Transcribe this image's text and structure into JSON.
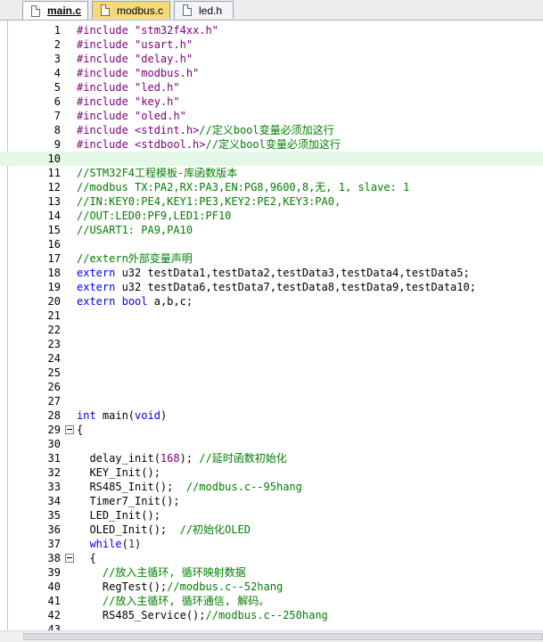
{
  "tabs": [
    {
      "label": "main.c"
    },
    {
      "label": "modbus.c"
    },
    {
      "label": "led.h"
    }
  ],
  "lines": [
    {
      "n": "1",
      "t": [
        [
          "pp",
          "#include "
        ],
        [
          "str",
          "\"stm32f4xx.h\""
        ]
      ]
    },
    {
      "n": "2",
      "t": [
        [
          "pp",
          "#include "
        ],
        [
          "str",
          "\"usart.h\""
        ]
      ]
    },
    {
      "n": "3",
      "t": [
        [
          "pp",
          "#include "
        ],
        [
          "str",
          "\"delay.h\""
        ]
      ]
    },
    {
      "n": "4",
      "t": [
        [
          "pp",
          "#include "
        ],
        [
          "str",
          "\"modbus.h\""
        ]
      ]
    },
    {
      "n": "5",
      "t": [
        [
          "pp",
          "#include "
        ],
        [
          "str",
          "\"led.h\""
        ]
      ]
    },
    {
      "n": "6",
      "t": [
        [
          "pp",
          "#include "
        ],
        [
          "str",
          "\"key.h\""
        ]
      ]
    },
    {
      "n": "7",
      "t": [
        [
          "pp",
          "#include "
        ],
        [
          "str",
          "\"oled.h\""
        ]
      ]
    },
    {
      "n": "8",
      "t": [
        [
          "pp",
          "#include "
        ],
        [
          "str",
          "<stdint.h>"
        ],
        [
          "c",
          "//定义bool变量必须加这行"
        ]
      ]
    },
    {
      "n": "9",
      "t": [
        [
          "pp",
          "#include "
        ],
        [
          "str",
          "<stdbool.h>"
        ],
        [
          "c",
          "//定义bool变量必须加这行"
        ]
      ]
    },
    {
      "n": "10",
      "hl": true,
      "t": []
    },
    {
      "n": "11",
      "t": [
        [
          "c",
          "//STM32F4工程模板-库函数版本"
        ]
      ]
    },
    {
      "n": "12",
      "t": [
        [
          "c",
          "//modbus TX:PA2,RX:PA3,EN:PG8,9600,8,无, 1, slave: 1"
        ]
      ]
    },
    {
      "n": "13",
      "t": [
        [
          "c",
          "//IN:KEY0:PE4,KEY1:PE3,KEY2:PE2,KEY3:PA0,"
        ]
      ]
    },
    {
      "n": "14",
      "t": [
        [
          "c",
          "//OUT:LED0:PF9,LED1:PF10"
        ]
      ]
    },
    {
      "n": "15",
      "t": [
        [
          "c",
          "//USART1: PA9,PA10"
        ]
      ]
    },
    {
      "n": "16",
      "t": []
    },
    {
      "n": "17",
      "t": [
        [
          "c",
          "//extern外部变量声明"
        ]
      ]
    },
    {
      "n": "18",
      "t": [
        [
          "k",
          "extern"
        ],
        [
          "p",
          " u32 testData1,testData2,testData3,testData4,testData5;"
        ]
      ]
    },
    {
      "n": "19",
      "t": [
        [
          "k",
          "extern"
        ],
        [
          "p",
          " u32 testData6,testData7,testData8,testData9,testData10;"
        ]
      ]
    },
    {
      "n": "20",
      "t": [
        [
          "k",
          "extern"
        ],
        [
          "p",
          " "
        ],
        [
          "k",
          "bool"
        ],
        [
          "p",
          " a,b,c;"
        ]
      ]
    },
    {
      "n": "21",
      "t": []
    },
    {
      "n": "22",
      "t": []
    },
    {
      "n": "23",
      "t": []
    },
    {
      "n": "24",
      "t": []
    },
    {
      "n": "25",
      "t": []
    },
    {
      "n": "26",
      "t": []
    },
    {
      "n": "27",
      "t": []
    },
    {
      "n": "28",
      "t": [
        [
          "k",
          "int"
        ],
        [
          "p",
          " main("
        ],
        [
          "k",
          "void"
        ],
        [
          "p",
          ")"
        ]
      ]
    },
    {
      "n": "29",
      "fold": true,
      "t": [
        [
          "p",
          "{"
        ]
      ]
    },
    {
      "n": "30",
      "t": []
    },
    {
      "n": "31",
      "t": [
        [
          "p",
          "  delay_init("
        ],
        [
          "n",
          "168"
        ],
        [
          "p",
          "); "
        ],
        [
          "c",
          "//延时函数初始化"
        ]
      ]
    },
    {
      "n": "32",
      "t": [
        [
          "p",
          "  KEY_Init();"
        ]
      ]
    },
    {
      "n": "33",
      "t": [
        [
          "p",
          "  RS485_Init();  "
        ],
        [
          "c",
          "//modbus.c--95hang"
        ]
      ]
    },
    {
      "n": "34",
      "t": [
        [
          "p",
          "  Timer7_Init();"
        ]
      ]
    },
    {
      "n": "35",
      "t": [
        [
          "p",
          "  LED_Init();"
        ]
      ]
    },
    {
      "n": "36",
      "t": [
        [
          "p",
          "  OLED_Init();  "
        ],
        [
          "c",
          "//初始化OLED"
        ]
      ]
    },
    {
      "n": "37",
      "t": [
        [
          "p",
          "  "
        ],
        [
          "k",
          "while"
        ],
        [
          "p",
          "("
        ],
        [
          "n",
          "1"
        ],
        [
          "p",
          ")"
        ]
      ]
    },
    {
      "n": "38",
      "fold": true,
      "t": [
        [
          "p",
          "  {"
        ]
      ]
    },
    {
      "n": "39",
      "t": [
        [
          "p",
          "    "
        ],
        [
          "c",
          "//放入主循环, 循环映射数据"
        ]
      ]
    },
    {
      "n": "40",
      "t": [
        [
          "p",
          "    RegTest();"
        ],
        [
          "c",
          "//modbus.c--52hang"
        ]
      ]
    },
    {
      "n": "41",
      "t": [
        [
          "p",
          "    "
        ],
        [
          "c",
          "//放入主循环, 循环通信, 解码。"
        ]
      ]
    },
    {
      "n": "42",
      "t": [
        [
          "p",
          "    RS485_Service();"
        ],
        [
          "c",
          "//modbus.c--250hang"
        ]
      ]
    },
    {
      "n": "43",
      "t": []
    }
  ]
}
